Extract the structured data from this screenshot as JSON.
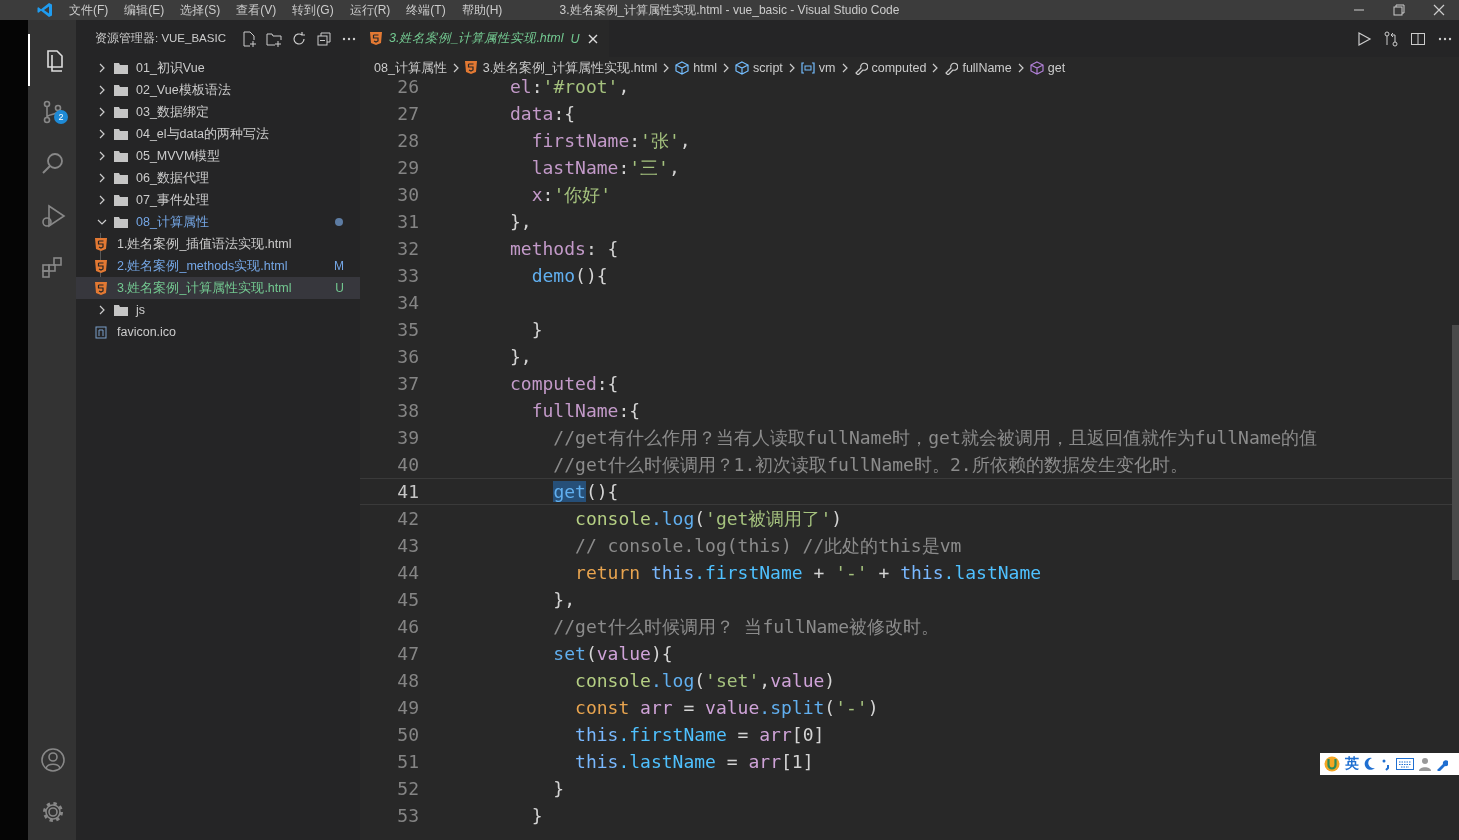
{
  "title_bar": {
    "menu": [
      "文件(F)",
      "编辑(E)",
      "选择(S)",
      "查看(V)",
      "转到(G)",
      "运行(R)",
      "终端(T)",
      "帮助(H)"
    ],
    "title": "3.姓名案例_计算属性实现.html - vue_basic - Visual Studio Code"
  },
  "activity_bar": {
    "items": [
      {
        "kind": "files",
        "selected": true
      },
      {
        "kind": "source-control",
        "selected": false,
        "badge": "2"
      },
      {
        "kind": "search",
        "selected": false
      },
      {
        "kind": "debug",
        "selected": false
      },
      {
        "kind": "extensions",
        "selected": false
      }
    ],
    "bottom": [
      {
        "kind": "account"
      },
      {
        "kind": "settings"
      }
    ]
  },
  "sidebar": {
    "title": "资源管理器: VUE_BASIC",
    "tree": [
      {
        "name": "01_初识Vue",
        "kind": "folder",
        "expanded": false,
        "selected": false,
        "dot": false
      },
      {
        "name": "02_Vue模板语法",
        "kind": "folder",
        "expanded": false,
        "selected": false,
        "dot": false
      },
      {
        "name": "03_数据绑定",
        "kind": "folder",
        "expanded": false,
        "selected": false,
        "dot": false
      },
      {
        "name": "04_el与data的两种写法",
        "kind": "folder",
        "expanded": false,
        "selected": false,
        "dot": false
      },
      {
        "name": "05_MVVM模型",
        "kind": "folder",
        "expanded": false,
        "selected": false,
        "dot": false
      },
      {
        "name": "06_数据代理",
        "kind": "folder",
        "expanded": false,
        "selected": false,
        "dot": false
      },
      {
        "name": "07_事件处理",
        "kind": "folder",
        "expanded": false,
        "selected": false,
        "dot": false
      },
      {
        "name": "08_计算属性",
        "kind": "folder",
        "expanded": true,
        "selected": false,
        "dot": true,
        "color": "#75a7e6",
        "children": [
          {
            "name": "1.姓名案例_插值语法实现.html",
            "kind": "html",
            "selected": false
          },
          {
            "name": "2.姓名案例_methods实现.html",
            "kind": "html",
            "selected": false,
            "badge": "M",
            "color": "#75a7e6"
          },
          {
            "name": "3.姓名案例_计算属性实现.html",
            "kind": "html",
            "selected": true,
            "badge": "U",
            "color": "#73c991"
          }
        ]
      },
      {
        "name": "js",
        "kind": "folder",
        "expanded": false,
        "selected": false,
        "dot": false
      },
      {
        "name": "favicon.ico",
        "kind": "image",
        "selected": false
      }
    ]
  },
  "tab": {
    "label": "3.姓名案例_计算属性实现.html",
    "badge": "U"
  },
  "breadcrumbs": [
    {
      "label": "08_计算属性",
      "kind": "none"
    },
    {
      "label": "3.姓名案例_计算属性实现.html",
      "kind": "html"
    },
    {
      "label": "html",
      "kind": "element"
    },
    {
      "label": "script",
      "kind": "element"
    },
    {
      "label": "vm",
      "kind": "variable"
    },
    {
      "label": "computed",
      "kind": "property"
    },
    {
      "label": "fullName",
      "kind": "property"
    },
    {
      "label": "get",
      "kind": "method"
    }
  ],
  "code": {
    "lines": [
      {
        "number": "26",
        "current": false,
        "tokens": [
          {
            "text": "      el",
            "kind": "key"
          },
          {
            "text": ":",
            "kind": "p"
          },
          {
            "text": "'#root'",
            "kind": "str"
          },
          {
            "text": ",",
            "kind": "p"
          }
        ]
      },
      {
        "number": "27",
        "current": false,
        "tokens": [
          {
            "text": "      data",
            "kind": "key"
          },
          {
            "text": ":{",
            "kind": "p"
          }
        ]
      },
      {
        "number": "28",
        "current": false,
        "tokens": [
          {
            "text": "        firstName",
            "kind": "key"
          },
          {
            "text": ":",
            "kind": "p"
          },
          {
            "text": "'张'",
            "kind": "str"
          },
          {
            "text": ",",
            "kind": "p"
          }
        ]
      },
      {
        "number": "29",
        "current": false,
        "tokens": [
          {
            "text": "        lastName",
            "kind": "key"
          },
          {
            "text": ":",
            "kind": "p"
          },
          {
            "text": "'三'",
            "kind": "str"
          },
          {
            "text": ",",
            "kind": "p"
          }
        ]
      },
      {
        "number": "30",
        "current": false,
        "tokens": [
          {
            "text": "        x",
            "kind": "key"
          },
          {
            "text": ":",
            "kind": "p"
          },
          {
            "text": "'你好'",
            "kind": "str"
          }
        ]
      },
      {
        "number": "31",
        "current": false,
        "tokens": [
          {
            "text": "      },",
            "kind": "p"
          }
        ]
      },
      {
        "number": "32",
        "current": false,
        "tokens": [
          {
            "text": "      methods",
            "kind": "key"
          },
          {
            "text": ": {",
            "kind": "p"
          }
        ]
      },
      {
        "number": "33",
        "current": false,
        "tokens": [
          {
            "text": "        demo",
            "kind": "fn"
          },
          {
            "text": "(){",
            "kind": "p"
          }
        ]
      },
      {
        "number": "34",
        "current": false
      },
      {
        "number": "35",
        "current": false,
        "tokens": [
          {
            "text": "        }",
            "kind": "p"
          }
        ]
      },
      {
        "number": "36",
        "current": false,
        "tokens": [
          {
            "text": "      },",
            "kind": "p"
          }
        ]
      },
      {
        "number": "37",
        "current": false,
        "tokens": [
          {
            "text": "      computed",
            "kind": "key"
          },
          {
            "text": ":{",
            "kind": "p"
          }
        ]
      },
      {
        "number": "38",
        "current": false,
        "tokens": [
          {
            "text": "        fullName",
            "kind": "key"
          },
          {
            "text": ":{",
            "kind": "p"
          }
        ]
      },
      {
        "number": "39",
        "current": false,
        "tokens": [
          {
            "text": "          //get有什么作用？当有人读取fullName时，get就会被调用，且返回值就作为fullName的值",
            "kind": "comment"
          }
        ]
      },
      {
        "number": "40",
        "current": false,
        "tokens": [
          {
            "text": "          //get什么时候调用？1.初次读取fullName时。2.所依赖的数据发生变化时。",
            "kind": "comment"
          }
        ]
      },
      {
        "number": "41",
        "current": true,
        "tokens": [
          {
            "text": "          get",
            "kind": "fn-selected"
          },
          {
            "text": "(){",
            "kind": "p"
          }
        ]
      },
      {
        "number": "42",
        "current": false,
        "tokens": [
          {
            "text": "            console",
            "kind": "obj"
          },
          {
            "text": ".log",
            "kind": "fn"
          },
          {
            "text": "(",
            "kind": "p"
          },
          {
            "text": "'get被调用了'",
            "kind": "str"
          },
          {
            "text": ")",
            "kind": "p"
          }
        ]
      },
      {
        "number": "43",
        "current": false,
        "tokens": [
          {
            "text": "            // console.log(this) //此处的this是vm",
            "kind": "comment"
          }
        ]
      },
      {
        "number": "44",
        "current": false,
        "tokens": [
          {
            "text": "            return",
            "kind": "ctrl"
          },
          {
            "text": " this",
            "kind": "this"
          },
          {
            "text": ".firstName",
            "kind": "member"
          },
          {
            "text": " + ",
            "kind": "p"
          },
          {
            "text": "'-'",
            "kind": "str"
          },
          {
            "text": " + ",
            "kind": "p"
          },
          {
            "text": "this",
            "kind": "this"
          },
          {
            "text": ".lastName",
            "kind": "member"
          }
        ]
      },
      {
        "number": "45",
        "current": false,
        "tokens": [
          {
            "text": "          },",
            "kind": "p"
          }
        ]
      },
      {
        "number": "46",
        "current": false,
        "tokens": [
          {
            "text": "          //get什么时候调用？ 当fullName被修改时。",
            "kind": "comment"
          }
        ]
      },
      {
        "number": "47",
        "current": false,
        "tokens": [
          {
            "text": "          set",
            "kind": "fn"
          },
          {
            "text": "(",
            "kind": "p"
          },
          {
            "text": "value",
            "kind": "param"
          },
          {
            "text": "){",
            "kind": "p"
          }
        ]
      },
      {
        "number": "48",
        "current": false,
        "tokens": [
          {
            "text": "            console",
            "kind": "obj"
          },
          {
            "text": ".log",
            "kind": "fn"
          },
          {
            "text": "(",
            "kind": "p"
          },
          {
            "text": "'set'",
            "kind": "str"
          },
          {
            "text": ",",
            "kind": "p"
          },
          {
            "text": "value",
            "kind": "param"
          },
          {
            "text": ")",
            "kind": "p"
          }
        ]
      },
      {
        "number": "49",
        "current": false,
        "tokens": [
          {
            "text": "            const",
            "kind": "ctrl"
          },
          {
            "text": " arr",
            "kind": "param"
          },
          {
            "text": " = ",
            "kind": "p"
          },
          {
            "text": "value",
            "kind": "param"
          },
          {
            "text": ".split",
            "kind": "fn"
          },
          {
            "text": "(",
            "kind": "p"
          },
          {
            "text": "'-'",
            "kind": "str"
          },
          {
            "text": ")",
            "kind": "p"
          }
        ]
      },
      {
        "number": "50",
        "current": false,
        "tokens": [
          {
            "text": "            this",
            "kind": "this"
          },
          {
            "text": ".firstName",
            "kind": "member"
          },
          {
            "text": " = ",
            "kind": "p"
          },
          {
            "text": "arr",
            "kind": "param"
          },
          {
            "text": "[0]",
            "kind": "p"
          }
        ]
      },
      {
        "number": "51",
        "current": false,
        "tokens": [
          {
            "text": "            this",
            "kind": "this"
          },
          {
            "text": ".lastName",
            "kind": "member"
          },
          {
            "text": " = ",
            "kind": "p"
          },
          {
            "text": "arr",
            "kind": "param"
          },
          {
            "text": "[1]",
            "kind": "p"
          }
        ]
      },
      {
        "number": "52",
        "current": false,
        "tokens": [
          {
            "text": "          }",
            "kind": "p"
          }
        ]
      },
      {
        "number": "53",
        "current": false,
        "tokens": [
          {
            "text": "        }",
            "kind": "p"
          }
        ]
      }
    ]
  },
  "ime_toolbar": {
    "label": "英"
  }
}
